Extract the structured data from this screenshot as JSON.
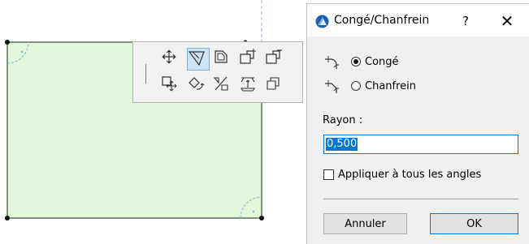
{
  "canvas": {
    "fill_color": "#e3f7dd",
    "edge_color": "#3a4a3a",
    "guide_color": "#7fb4e6"
  },
  "pet_palette": {
    "buttons": [
      {
        "icon": "move-icon",
        "active": false
      },
      {
        "icon": "fillet-chamfer-icon",
        "active": true
      },
      {
        "icon": "offset-edge-icon",
        "active": false
      },
      {
        "icon": "add-to-polygon-icon",
        "active": false
      },
      {
        "icon": "subtract-from-polygon-icon",
        "active": false
      },
      {
        "icon": "drag-copy-icon",
        "active": false
      },
      {
        "icon": "rotate-icon",
        "active": false
      },
      {
        "icon": "mirror-icon",
        "active": false
      },
      {
        "icon": "elevate-icon",
        "active": false
      },
      {
        "icon": "multiply-icon",
        "active": false
      }
    ]
  },
  "dialog": {
    "title": "Congé/Chanfrein",
    "help_label": "?",
    "close_label": "✕",
    "options": [
      {
        "label": "Congé",
        "selected": true,
        "icon": "fillet-shape-icon"
      },
      {
        "label": "Chanfrein",
        "selected": false,
        "icon": "chamfer-shape-icon"
      }
    ],
    "radius_label": "Rayon :",
    "radius_value": "0,500",
    "apply_all_label": "Appliquer à tous les angles",
    "apply_all_checked": false,
    "cancel_label": "Annuler",
    "ok_label": "OK",
    "accent_color": "#0078d7"
  }
}
